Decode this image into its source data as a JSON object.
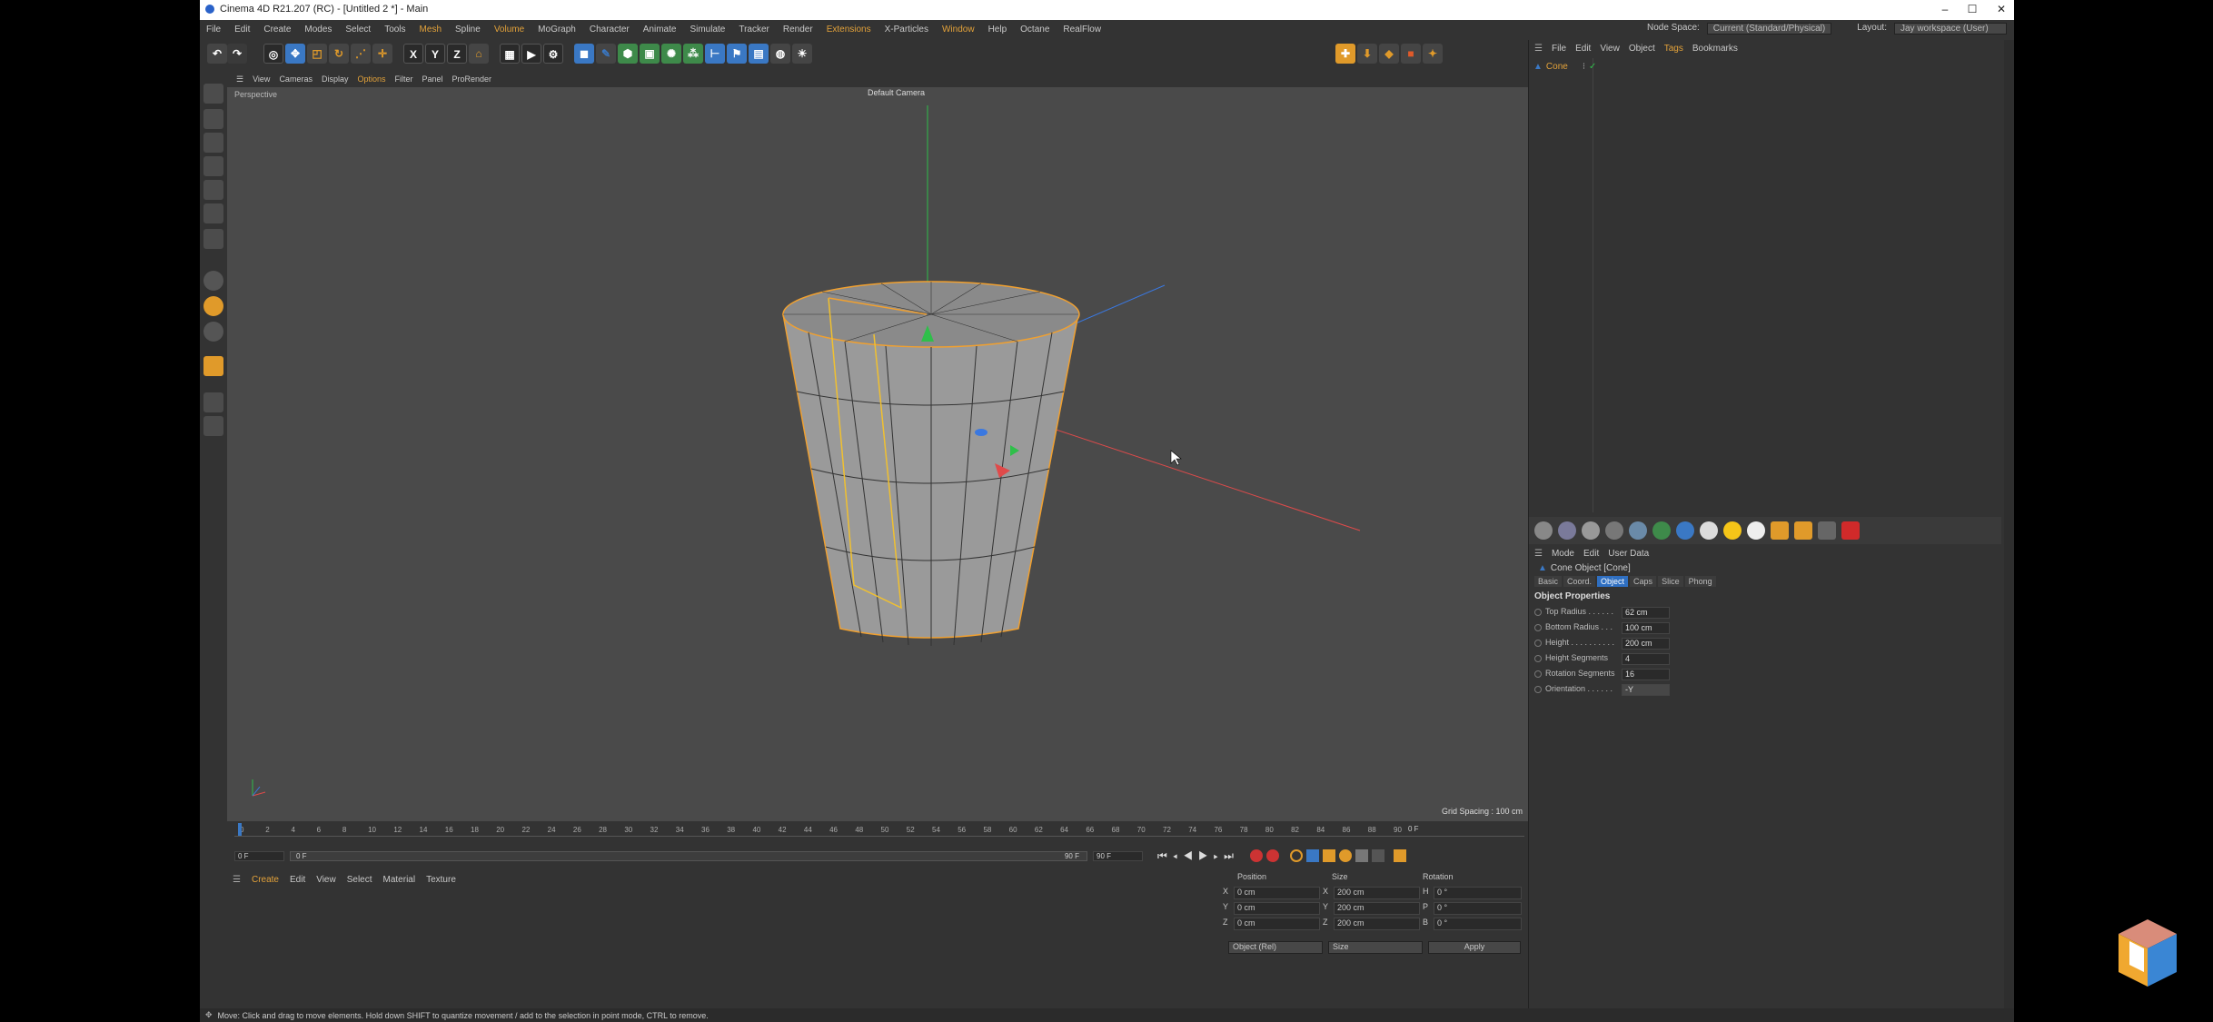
{
  "window": {
    "title": "Cinema 4D R21.207 (RC) - [Untitled 2 *] - Main"
  },
  "menubar": {
    "items": [
      "File",
      "Edit",
      "Create",
      "Modes",
      "Select",
      "Tools",
      "Mesh",
      "Spline",
      "Volume",
      "MoGraph",
      "Character",
      "Animate",
      "Simulate",
      "Tracker",
      "Render",
      "Extensions",
      "X-Particles",
      "Window",
      "Help",
      "Octane",
      "RealFlow"
    ],
    "highlighted": [
      "Mesh",
      "Volume",
      "Extensions",
      "Window"
    ],
    "node_space_label": "Node Space:",
    "node_space_value": "Current (Standard/Physical)",
    "layout_label": "Layout:",
    "layout_value": "Jay workspace (User)"
  },
  "viewport": {
    "menu": [
      "View",
      "Cameras",
      "Display",
      "Options",
      "Filter",
      "Panel",
      "ProRender"
    ],
    "menu_highlighted": [
      "Options"
    ],
    "projection": "Perspective",
    "camera": "Default Camera",
    "grid_spacing": "Grid Spacing : 100 cm"
  },
  "timeline": {
    "ticks": [
      "0",
      "2",
      "4",
      "6",
      "8",
      "10",
      "12",
      "14",
      "16",
      "18",
      "20",
      "22",
      "24",
      "26",
      "28",
      "30",
      "32",
      "34",
      "36",
      "38",
      "40",
      "42",
      "44",
      "46",
      "48",
      "50",
      "52",
      "54",
      "56",
      "58",
      "60",
      "62",
      "64",
      "66",
      "68",
      "70",
      "72",
      "74",
      "76",
      "78",
      "80",
      "82",
      "84",
      "86",
      "88",
      "90"
    ],
    "current_frame": "0 F",
    "start_frame": "0 F",
    "preview_start": "0 F",
    "preview_end": "90 F",
    "end_frame": "90 F"
  },
  "material_manager": {
    "menu": [
      "Create",
      "Edit",
      "View",
      "Select",
      "Material",
      "Texture"
    ]
  },
  "coordinates": {
    "headers": [
      "Position",
      "Size",
      "Rotation"
    ],
    "rows": [
      {
        "axis": "X",
        "pos": "0 cm",
        "size_axis": "X",
        "size": "200 cm",
        "rot_axis": "H",
        "rot": "0 °"
      },
      {
        "axis": "Y",
        "pos": "0 cm",
        "size_axis": "Y",
        "size": "200 cm",
        "rot_axis": "P",
        "rot": "0 °"
      },
      {
        "axis": "Z",
        "pos": "0 cm",
        "size_axis": "Z",
        "size": "200 cm",
        "rot_axis": "B",
        "rot": "0 °"
      }
    ],
    "mode": "Object (Rel)",
    "size_mode": "Size",
    "apply": "Apply"
  },
  "object_manager": {
    "menu": [
      "File",
      "Edit",
      "View",
      "Object",
      "Tags",
      "Bookmarks"
    ],
    "menu_highlighted": [
      "Tags"
    ],
    "objects": [
      "Cone"
    ]
  },
  "attribute_manager": {
    "menu": [
      "Mode",
      "Edit",
      "User Data"
    ],
    "object_title": "Cone Object [Cone]",
    "tabs": [
      "Basic",
      "Coord.",
      "Object",
      "Caps",
      "Slice",
      "Phong"
    ],
    "active_tab": "Object",
    "section": "Object Properties",
    "properties": [
      {
        "label": "Top Radius . . . . . .",
        "value": "62 cm"
      },
      {
        "label": "Bottom Radius . . .",
        "value": "100 cm"
      },
      {
        "label": "Height . . . . . . . . . .",
        "value": "200 cm"
      },
      {
        "label": "Height Segments",
        "value": "4"
      },
      {
        "label": "Rotation Segments",
        "value": "16"
      },
      {
        "label": "Orientation . . . . . .",
        "value": "-Y"
      }
    ]
  },
  "status": "Move: Click and drag to move elements. Hold down SHIFT to quantize movement / add to the selection in point mode, CTRL to remove.",
  "colors": {
    "accent": "#e3a23a",
    "selection_blue": "#2f6fc1"
  }
}
